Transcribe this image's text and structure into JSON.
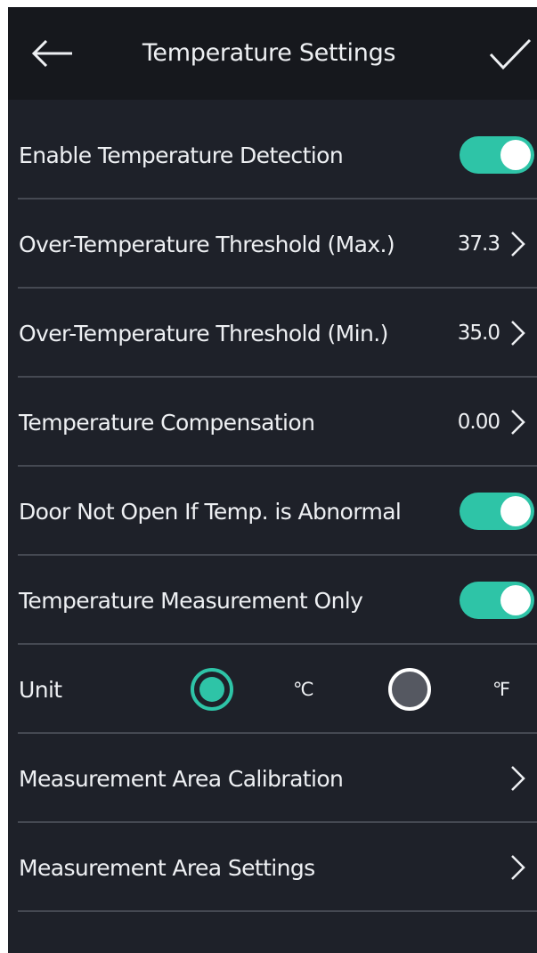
{
  "header": {
    "title": "Temperature Settings",
    "back_icon": "arrow-left-icon",
    "confirm_icon": "checkmark-icon"
  },
  "rows": {
    "enable_detection": {
      "label": "Enable Temperature Detection",
      "enabled": true
    },
    "threshold_max": {
      "label": "Over-Temperature Threshold (Max.)",
      "value": "37.3"
    },
    "threshold_min": {
      "label": "Over-Temperature Threshold (Min.)",
      "value": "35.0"
    },
    "compensation": {
      "label": "Temperature Compensation",
      "value": "0.00"
    },
    "door_not_open": {
      "label": "Door Not Open If Temp. is Abnormal",
      "enabled": true
    },
    "measurement_only": {
      "label": "Temperature Measurement Only",
      "enabled": true
    },
    "unit": {
      "label": "Unit",
      "options": [
        {
          "label": "℃",
          "selected": true
        },
        {
          "label": "℉",
          "selected": false
        }
      ]
    },
    "area_calibration": {
      "label": "Measurement Area Calibration"
    },
    "area_settings": {
      "label": "Measurement Area Settings"
    }
  },
  "colors": {
    "background": "#1e2129",
    "header_background": "#16181d",
    "accent": "#2ec4a7",
    "divider": "#454952",
    "text": "#eef0f3"
  }
}
